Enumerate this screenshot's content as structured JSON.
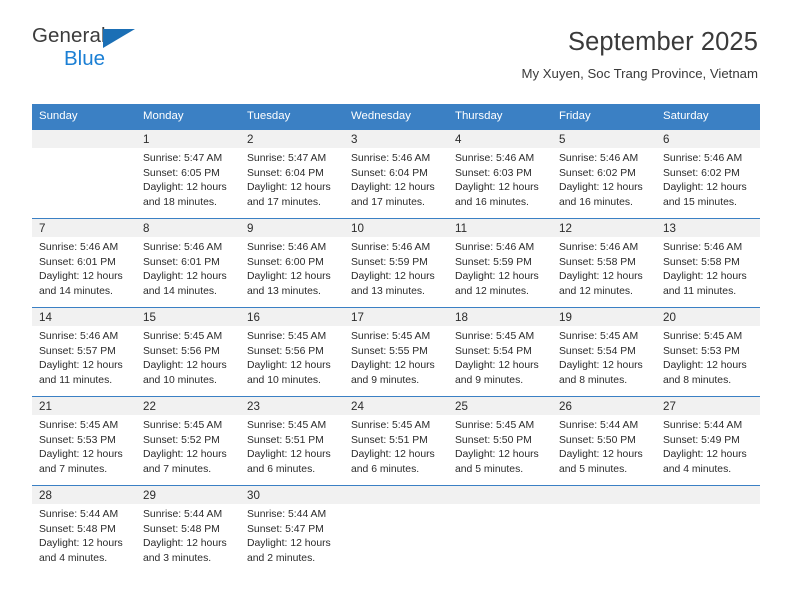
{
  "brand": {
    "name_top": "General",
    "name_bottom": "Blue",
    "accent_color": "#1b7fd4",
    "triangle_color": "#1b6fb5"
  },
  "header": {
    "title": "September 2025",
    "subtitle": "My Xuyen, Soc Trang Province, Vietnam"
  },
  "calendar": {
    "header_bg": "#3b80c4",
    "daynum_bg": "#f1f1f1",
    "weekday_headers": [
      "Sunday",
      "Monday",
      "Tuesday",
      "Wednesday",
      "Thursday",
      "Friday",
      "Saturday"
    ],
    "weeks": [
      [
        {
          "day": "",
          "sunrise": "",
          "sunset": "",
          "daylight_line1": "",
          "daylight_line2": ""
        },
        {
          "day": "1",
          "sunrise": "Sunrise: 5:47 AM",
          "sunset": "Sunset: 6:05 PM",
          "daylight_line1": "Daylight: 12 hours",
          "daylight_line2": "and 18 minutes."
        },
        {
          "day": "2",
          "sunrise": "Sunrise: 5:47 AM",
          "sunset": "Sunset: 6:04 PM",
          "daylight_line1": "Daylight: 12 hours",
          "daylight_line2": "and 17 minutes."
        },
        {
          "day": "3",
          "sunrise": "Sunrise: 5:46 AM",
          "sunset": "Sunset: 6:04 PM",
          "daylight_line1": "Daylight: 12 hours",
          "daylight_line2": "and 17 minutes."
        },
        {
          "day": "4",
          "sunrise": "Sunrise: 5:46 AM",
          "sunset": "Sunset: 6:03 PM",
          "daylight_line1": "Daylight: 12 hours",
          "daylight_line2": "and 16 minutes."
        },
        {
          "day": "5",
          "sunrise": "Sunrise: 5:46 AM",
          "sunset": "Sunset: 6:02 PM",
          "daylight_line1": "Daylight: 12 hours",
          "daylight_line2": "and 16 minutes."
        },
        {
          "day": "6",
          "sunrise": "Sunrise: 5:46 AM",
          "sunset": "Sunset: 6:02 PM",
          "daylight_line1": "Daylight: 12 hours",
          "daylight_line2": "and 15 minutes."
        }
      ],
      [
        {
          "day": "7",
          "sunrise": "Sunrise: 5:46 AM",
          "sunset": "Sunset: 6:01 PM",
          "daylight_line1": "Daylight: 12 hours",
          "daylight_line2": "and 14 minutes."
        },
        {
          "day": "8",
          "sunrise": "Sunrise: 5:46 AM",
          "sunset": "Sunset: 6:01 PM",
          "daylight_line1": "Daylight: 12 hours",
          "daylight_line2": "and 14 minutes."
        },
        {
          "day": "9",
          "sunrise": "Sunrise: 5:46 AM",
          "sunset": "Sunset: 6:00 PM",
          "daylight_line1": "Daylight: 12 hours",
          "daylight_line2": "and 13 minutes."
        },
        {
          "day": "10",
          "sunrise": "Sunrise: 5:46 AM",
          "sunset": "Sunset: 5:59 PM",
          "daylight_line1": "Daylight: 12 hours",
          "daylight_line2": "and 13 minutes."
        },
        {
          "day": "11",
          "sunrise": "Sunrise: 5:46 AM",
          "sunset": "Sunset: 5:59 PM",
          "daylight_line1": "Daylight: 12 hours",
          "daylight_line2": "and 12 minutes."
        },
        {
          "day": "12",
          "sunrise": "Sunrise: 5:46 AM",
          "sunset": "Sunset: 5:58 PM",
          "daylight_line1": "Daylight: 12 hours",
          "daylight_line2": "and 12 minutes."
        },
        {
          "day": "13",
          "sunrise": "Sunrise: 5:46 AM",
          "sunset": "Sunset: 5:58 PM",
          "daylight_line1": "Daylight: 12 hours",
          "daylight_line2": "and 11 minutes."
        }
      ],
      [
        {
          "day": "14",
          "sunrise": "Sunrise: 5:46 AM",
          "sunset": "Sunset: 5:57 PM",
          "daylight_line1": "Daylight: 12 hours",
          "daylight_line2": "and 11 minutes."
        },
        {
          "day": "15",
          "sunrise": "Sunrise: 5:45 AM",
          "sunset": "Sunset: 5:56 PM",
          "daylight_line1": "Daylight: 12 hours",
          "daylight_line2": "and 10 minutes."
        },
        {
          "day": "16",
          "sunrise": "Sunrise: 5:45 AM",
          "sunset": "Sunset: 5:56 PM",
          "daylight_line1": "Daylight: 12 hours",
          "daylight_line2": "and 10 minutes."
        },
        {
          "day": "17",
          "sunrise": "Sunrise: 5:45 AM",
          "sunset": "Sunset: 5:55 PM",
          "daylight_line1": "Daylight: 12 hours",
          "daylight_line2": "and 9 minutes."
        },
        {
          "day": "18",
          "sunrise": "Sunrise: 5:45 AM",
          "sunset": "Sunset: 5:54 PM",
          "daylight_line1": "Daylight: 12 hours",
          "daylight_line2": "and 9 minutes."
        },
        {
          "day": "19",
          "sunrise": "Sunrise: 5:45 AM",
          "sunset": "Sunset: 5:54 PM",
          "daylight_line1": "Daylight: 12 hours",
          "daylight_line2": "and 8 minutes."
        },
        {
          "day": "20",
          "sunrise": "Sunrise: 5:45 AM",
          "sunset": "Sunset: 5:53 PM",
          "daylight_line1": "Daylight: 12 hours",
          "daylight_line2": "and 8 minutes."
        }
      ],
      [
        {
          "day": "21",
          "sunrise": "Sunrise: 5:45 AM",
          "sunset": "Sunset: 5:53 PM",
          "daylight_line1": "Daylight: 12 hours",
          "daylight_line2": "and 7 minutes."
        },
        {
          "day": "22",
          "sunrise": "Sunrise: 5:45 AM",
          "sunset": "Sunset: 5:52 PM",
          "daylight_line1": "Daylight: 12 hours",
          "daylight_line2": "and 7 minutes."
        },
        {
          "day": "23",
          "sunrise": "Sunrise: 5:45 AM",
          "sunset": "Sunset: 5:51 PM",
          "daylight_line1": "Daylight: 12 hours",
          "daylight_line2": "and 6 minutes."
        },
        {
          "day": "24",
          "sunrise": "Sunrise: 5:45 AM",
          "sunset": "Sunset: 5:51 PM",
          "daylight_line1": "Daylight: 12 hours",
          "daylight_line2": "and 6 minutes."
        },
        {
          "day": "25",
          "sunrise": "Sunrise: 5:45 AM",
          "sunset": "Sunset: 5:50 PM",
          "daylight_line1": "Daylight: 12 hours",
          "daylight_line2": "and 5 minutes."
        },
        {
          "day": "26",
          "sunrise": "Sunrise: 5:44 AM",
          "sunset": "Sunset: 5:50 PM",
          "daylight_line1": "Daylight: 12 hours",
          "daylight_line2": "and 5 minutes."
        },
        {
          "day": "27",
          "sunrise": "Sunrise: 5:44 AM",
          "sunset": "Sunset: 5:49 PM",
          "daylight_line1": "Daylight: 12 hours",
          "daylight_line2": "and 4 minutes."
        }
      ],
      [
        {
          "day": "28",
          "sunrise": "Sunrise: 5:44 AM",
          "sunset": "Sunset: 5:48 PM",
          "daylight_line1": "Daylight: 12 hours",
          "daylight_line2": "and 4 minutes."
        },
        {
          "day": "29",
          "sunrise": "Sunrise: 5:44 AM",
          "sunset": "Sunset: 5:48 PM",
          "daylight_line1": "Daylight: 12 hours",
          "daylight_line2": "and 3 minutes."
        },
        {
          "day": "30",
          "sunrise": "Sunrise: 5:44 AM",
          "sunset": "Sunset: 5:47 PM",
          "daylight_line1": "Daylight: 12 hours",
          "daylight_line2": "and 2 minutes."
        },
        {
          "day": "",
          "sunrise": "",
          "sunset": "",
          "daylight_line1": "",
          "daylight_line2": ""
        },
        {
          "day": "",
          "sunrise": "",
          "sunset": "",
          "daylight_line1": "",
          "daylight_line2": ""
        },
        {
          "day": "",
          "sunrise": "",
          "sunset": "",
          "daylight_line1": "",
          "daylight_line2": ""
        },
        {
          "day": "",
          "sunrise": "",
          "sunset": "",
          "daylight_line1": "",
          "daylight_line2": ""
        }
      ]
    ]
  }
}
